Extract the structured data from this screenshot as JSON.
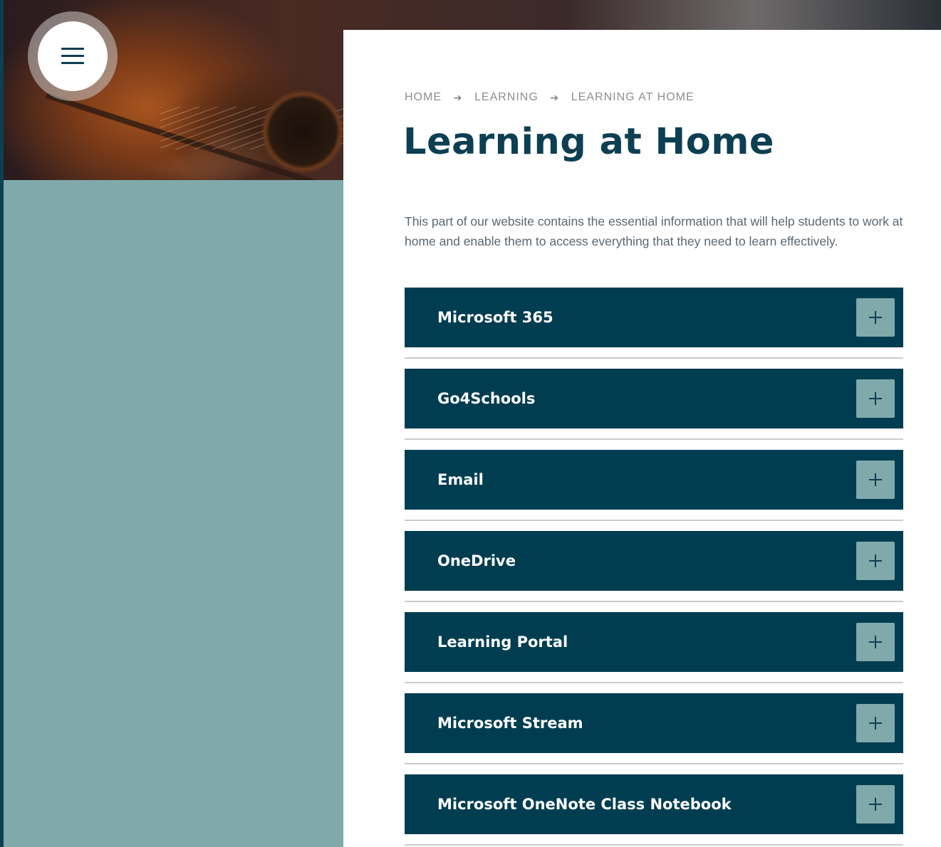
{
  "menu": {
    "icon": "hamburger-menu-icon"
  },
  "breadcrumb": {
    "items": [
      "HOME",
      "LEARNING",
      "LEARNING AT HOME"
    ],
    "separator_icon": "arrow-right-icon",
    "separator": "➔"
  },
  "page": {
    "title": "Learning at Home",
    "intro": "This part of our website contains the essential information that will help students to work at home and enable them to access everything that they need to learn effectively."
  },
  "accordion": {
    "toggle_icon": "plus-icon",
    "items": [
      {
        "label": "Microsoft 365"
      },
      {
        "label": "Go4Schools"
      },
      {
        "label": "Email"
      },
      {
        "label": "OneDrive"
      },
      {
        "label": "Learning Portal"
      },
      {
        "label": "Microsoft Stream"
      },
      {
        "label": "Microsoft OneNote Class Notebook"
      }
    ]
  },
  "colors": {
    "primary_dark": "#003d51",
    "accent_teal": "#80a9ab",
    "background": "#ffffff",
    "text_muted": "#5b6770"
  }
}
